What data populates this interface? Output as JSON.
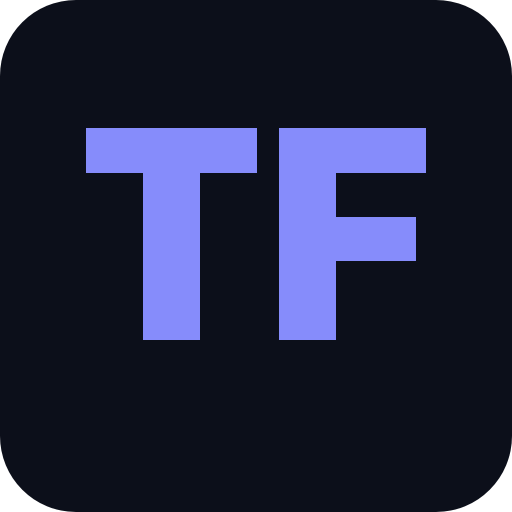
{
  "icon": {
    "monogram": "TF",
    "letters": [
      "T",
      "F"
    ],
    "background_color": "#0c0f1a",
    "letter_color": "#868cfb"
  }
}
